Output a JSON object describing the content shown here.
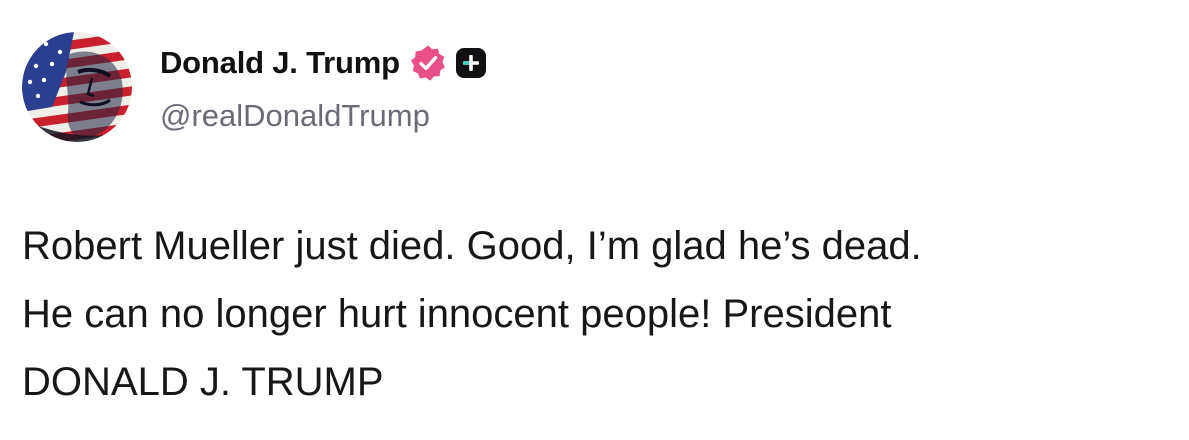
{
  "author": {
    "display_name": "Donald J. Trump",
    "handle": "@realDonaldTrump",
    "verified_icon": "verified-badge-icon",
    "subscription_icon": "plus-badge-icon",
    "avatar": "flag-painted-portrait-avatar"
  },
  "post": {
    "lines": [
      "Robert Mueller just died. Good, I’m glad he’s dead.",
      "He can no longer hurt innocent people! President",
      "DONALD J. TRUMP"
    ]
  },
  "colors": {
    "verified_badge": "#e9508a",
    "plus_badge": "#111114",
    "handle_text": "#6b6b78",
    "body_text": "#17171a"
  }
}
